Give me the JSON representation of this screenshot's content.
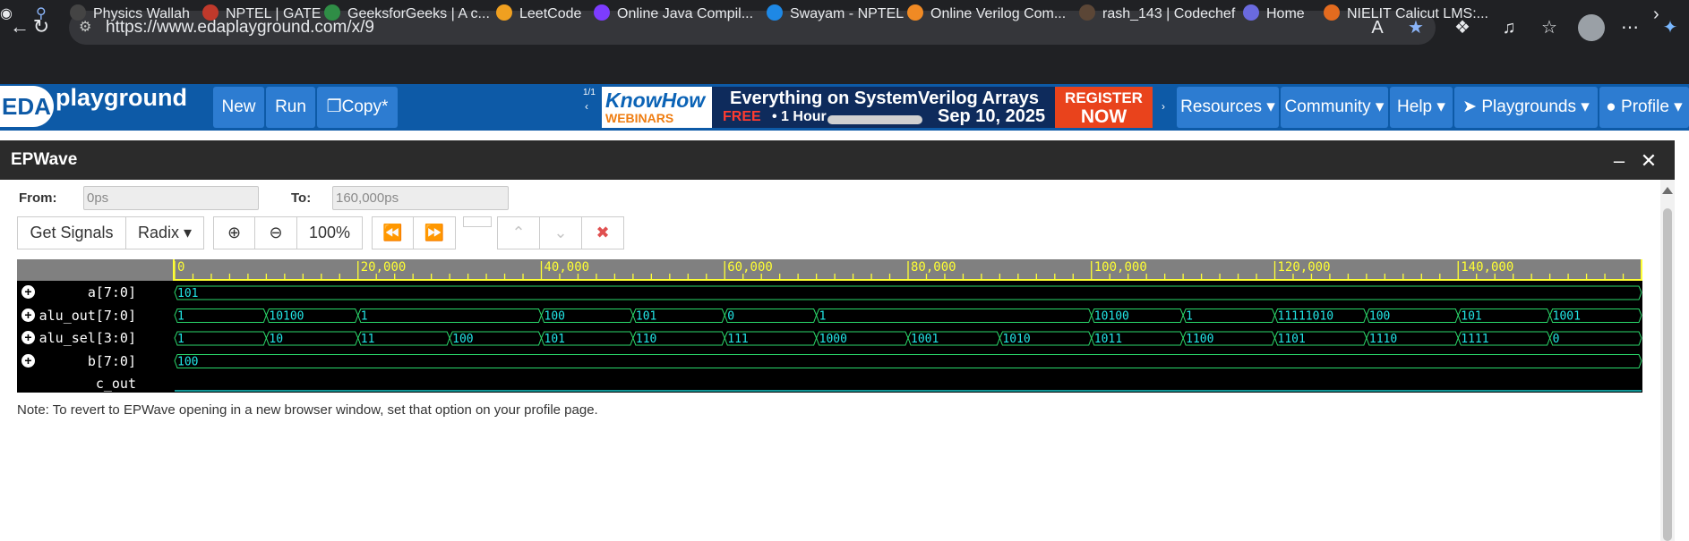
{
  "browser": {
    "url": "https://www.edaplayground.com/x/9",
    "bookmarks": [
      {
        "label": "Physics Wallah",
        "color": "#444"
      },
      {
        "label": "NPTEL | GATE",
        "color": "#c0392b"
      },
      {
        "label": "GeeksforGeeks | A c...",
        "color": "#2f8d46"
      },
      {
        "label": "LeetCode",
        "color": "#f0a020"
      },
      {
        "label": "Online Java Compil...",
        "color": "#7d3cff"
      },
      {
        "label": "Swayam - NPTEL",
        "color": "#1e88e5"
      },
      {
        "label": "Online Verilog Com...",
        "color": "#f08a24"
      },
      {
        "label": "rash_143 | Codechef",
        "color": "#5b4636"
      },
      {
        "label": "Home",
        "color": "#6a6adf"
      },
      {
        "label": "NIELIT Calicut LMS:...",
        "color": "#e36b1f"
      }
    ]
  },
  "eda": {
    "logo": "EDA",
    "brand": "playground",
    "buttons": {
      "new": "New",
      "run": "Run",
      "copy": "Copy"
    },
    "ad": {
      "counter": "1/1",
      "brand1": "KnowHow",
      "brand2": "WEBINARS",
      "title": "Everything on SystemVerilog Arrays",
      "free": "FREE",
      "hour": "• 1 Hour",
      "date": "Sep 10, 2025",
      "reg1": "REGISTER",
      "reg2": "NOW"
    },
    "nav": {
      "resources": "Resources",
      "community": "Community",
      "help": "Help",
      "playgrounds": "Playgrounds",
      "profile": "Profile"
    }
  },
  "epwave": {
    "title": "EPWave",
    "from_label": "From:",
    "from_value": "0ps",
    "to_label": "To:",
    "to_value": "160,000ps",
    "get_signals": "Get Signals",
    "radix": "Radix",
    "zoom": "100%",
    "note": "Note: To revert to EPWave opening in a new browser window, set that option on your profile page.",
    "time_start": 0,
    "time_end": 160000,
    "ticks": [
      "0",
      "20,000",
      "40,000",
      "60,000",
      "80,000",
      "100,000",
      "120,000",
      "140,000"
    ],
    "signals": [
      {
        "name": "a[7:0]",
        "expandable": true,
        "changes": [
          {
            "t": 0,
            "v": "101"
          }
        ]
      },
      {
        "name": "alu_out[7:0]",
        "expandable": true,
        "changes": [
          {
            "t": 0,
            "v": "1"
          },
          {
            "t": 10000,
            "v": "10100"
          },
          {
            "t": 20000,
            "v": "1"
          },
          {
            "t": 40000,
            "v": "100"
          },
          {
            "t": 50000,
            "v": "101"
          },
          {
            "t": 60000,
            "v": "0"
          },
          {
            "t": 70000,
            "v": "1"
          },
          {
            "t": 100000,
            "v": "10100"
          },
          {
            "t": 110000,
            "v": "1"
          },
          {
            "t": 120000,
            "v": "11111010"
          },
          {
            "t": 130000,
            "v": "100"
          },
          {
            "t": 140000,
            "v": "101"
          },
          {
            "t": 150000,
            "v": "1001"
          }
        ]
      },
      {
        "name": "alu_sel[3:0]",
        "expandable": true,
        "changes": [
          {
            "t": 0,
            "v": "1"
          },
          {
            "t": 10000,
            "v": "10"
          },
          {
            "t": 20000,
            "v": "11"
          },
          {
            "t": 30000,
            "v": "100"
          },
          {
            "t": 40000,
            "v": "101"
          },
          {
            "t": 50000,
            "v": "110"
          },
          {
            "t": 60000,
            "v": "111"
          },
          {
            "t": 70000,
            "v": "1000"
          },
          {
            "t": 80000,
            "v": "1001"
          },
          {
            "t": 90000,
            "v": "1010"
          },
          {
            "t": 100000,
            "v": "1011"
          },
          {
            "t": 110000,
            "v": "1100"
          },
          {
            "t": 120000,
            "v": "1101"
          },
          {
            "t": 130000,
            "v": "1110"
          },
          {
            "t": 140000,
            "v": "1111"
          },
          {
            "t": 150000,
            "v": "0"
          }
        ]
      },
      {
        "name": "b[7:0]",
        "expandable": true,
        "changes": [
          {
            "t": 0,
            "v": "100"
          }
        ]
      },
      {
        "name": "c_out",
        "expandable": false,
        "changes": [
          {
            "t": 0,
            "v": "0"
          }
        ]
      }
    ],
    "colors": {
      "value_text": "#22e6e6",
      "wave_line": "#2bd96b",
      "ruler": "#ffff33",
      "bit_line": "#18c8c8"
    }
  }
}
